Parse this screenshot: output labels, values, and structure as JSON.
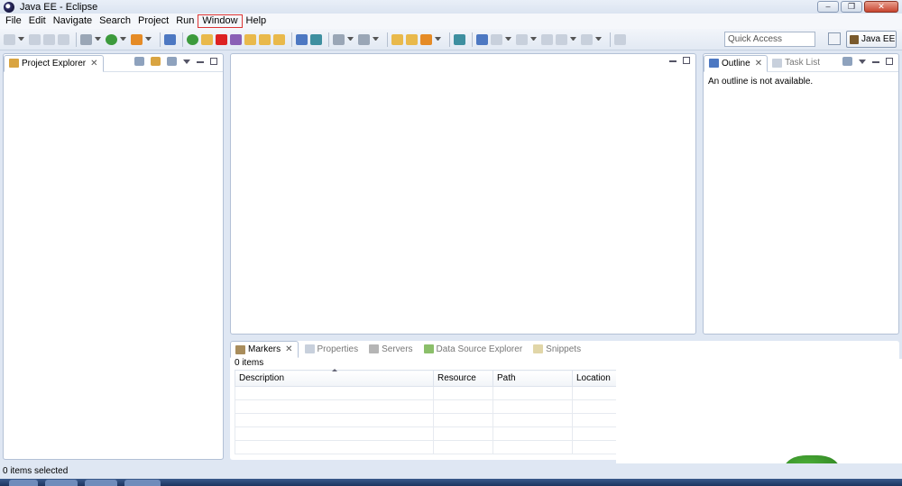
{
  "window": {
    "title": "Java EE - Eclipse",
    "controls": [
      "–",
      "❐",
      "✕"
    ]
  },
  "menu": [
    "File",
    "Edit",
    "Navigate",
    "Search",
    "Project",
    "Run",
    "Window",
    "Help"
  ],
  "toolbar": {
    "quick_access_placeholder": "Quick Access",
    "perspective_label": "Java EE"
  },
  "project_explorer": {
    "tab_label": "Project Explorer"
  },
  "outline": {
    "tabs": [
      "Outline",
      "Task List"
    ],
    "message": "An outline is not available."
  },
  "markers": {
    "tabs": [
      "Markers",
      "Properties",
      "Servers",
      "Data Source Explorer",
      "Snippets"
    ],
    "count": "0 items",
    "columns": [
      "Description",
      "Resource",
      "Path",
      "Location"
    ]
  },
  "status": {
    "text": "0 items selected"
  },
  "colors": {
    "highlight_border": "#dd3333",
    "chrome_bg": "#dfe7f3"
  }
}
